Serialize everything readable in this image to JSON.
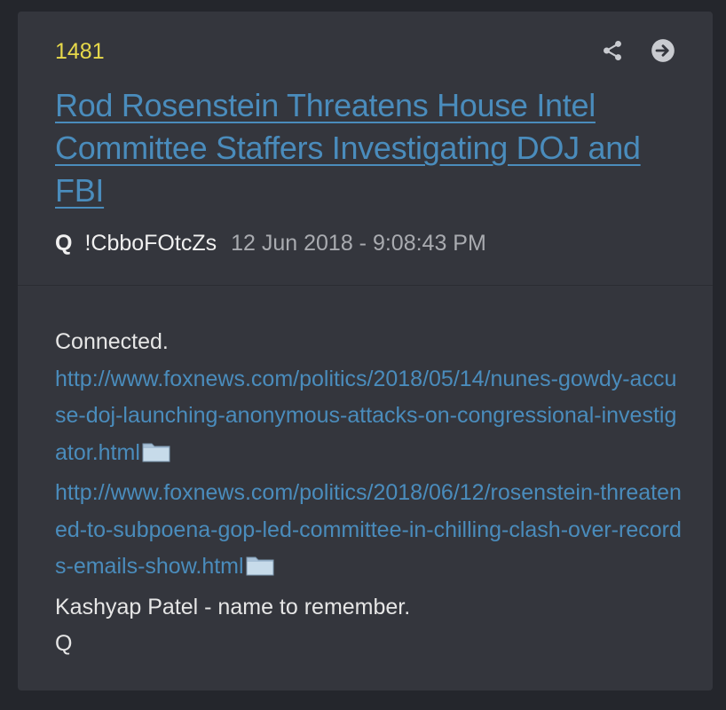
{
  "post": {
    "number": "1481",
    "title": "Rod Rosenstein Threatens House Intel Committee Staffers Investigating DOJ and FBI",
    "author": "Q",
    "tripcode": "!CbboFOtcZs",
    "timestamp": "12 Jun 2018 - 9:08:43 PM"
  },
  "body": {
    "line1": "Connected.",
    "link1": "http://www.foxnews.com/politics/2018/05/14/nunes-gowdy-accuse-doj-launching-anonymous-attacks-on-congressional-investigator.html",
    "link2": "http://www.foxnews.com/politics/2018/06/12/rosenstein-threatened-to-subpoena-gop-led-committee-in-chilling-clash-over-records-emails-show.html",
    "line4": "Kashyap Patel - name to remember.",
    "signature": "Q"
  },
  "icons": {
    "share": "share-icon",
    "goto": "arrow-right-circle-icon",
    "archive": "folder-icon"
  },
  "colors": {
    "background": "#24262c",
    "card": "#34363d",
    "post_number": "#e7d94a",
    "link": "#4a8cbc",
    "text": "#e6e6e6",
    "muted": "#a9abb0"
  }
}
